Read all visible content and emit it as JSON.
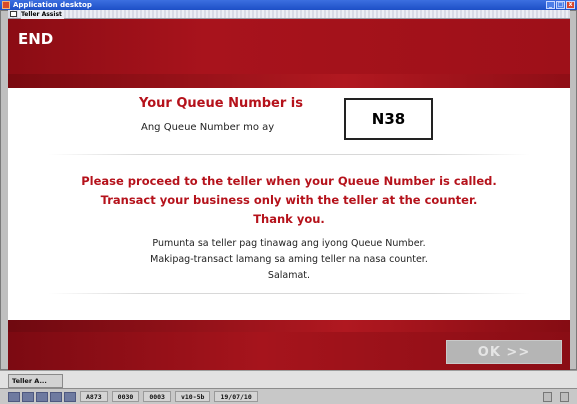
{
  "app": {
    "title": "Application desktop"
  },
  "window": {
    "title": "Teller Assist"
  },
  "header": {
    "title": "END"
  },
  "queue": {
    "heading": "Your Queue Number is",
    "subheading": "Ang Queue Number mo ay",
    "number": "N38"
  },
  "instructions_en": [
    "Please proceed to the teller when your Queue Number is called.",
    "Transact your business only with the teller at the counter.",
    "Thank you."
  ],
  "instructions_fil": [
    "Pumunta sa teller pag tinawag ang iyong Queue Number.",
    "Makipag-transact lamang sa aming teller na nasa counter.",
    "Salamat."
  ],
  "footer": {
    "ok_label": "OK  >>"
  },
  "taskbar": {
    "tab_label": "Teller A..."
  },
  "statusbar": {
    "cells": [
      "A873",
      "0030",
      "0003",
      "v10-5b",
      "19/07/10"
    ]
  }
}
